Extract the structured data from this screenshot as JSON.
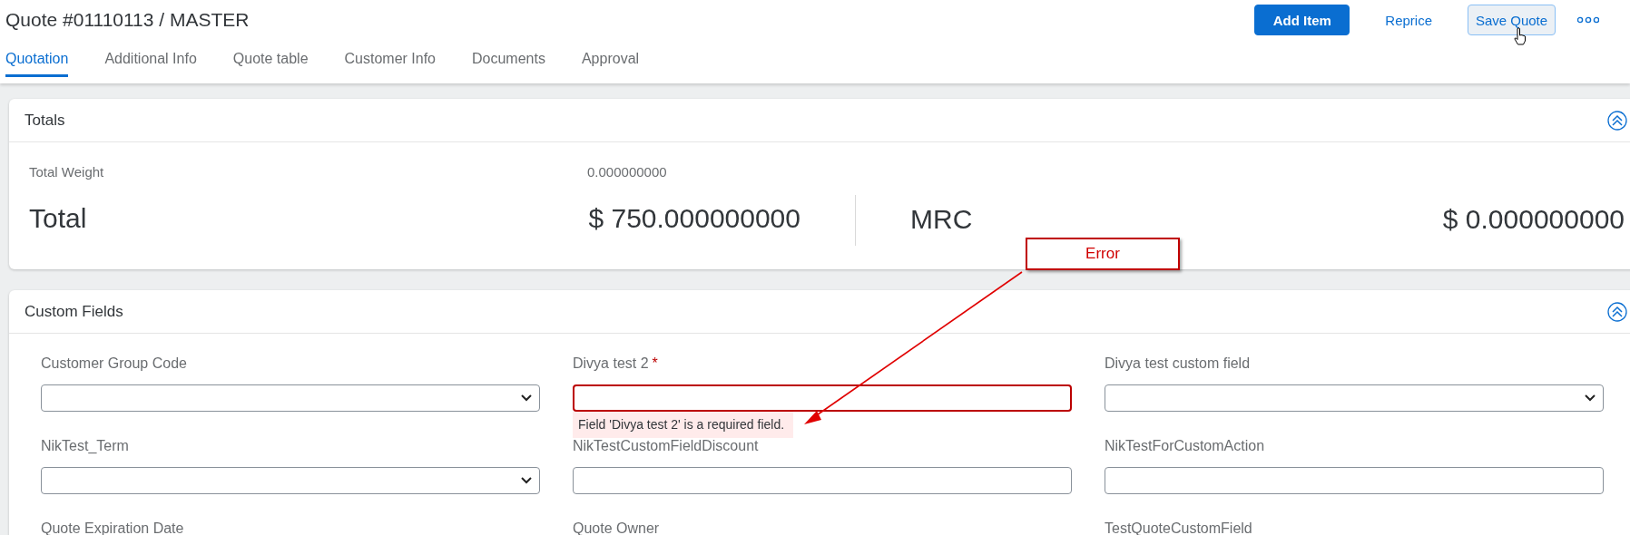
{
  "header": {
    "title": "Quote #01110113 / MASTER",
    "actions": [
      {
        "label": "Add Item",
        "kind": "primary"
      },
      {
        "label": "Reprice",
        "kind": "link"
      },
      {
        "label": "Save Quote",
        "kind": "hovered"
      },
      {
        "kind": "more"
      }
    ]
  },
  "tabs": [
    {
      "label": "Quotation",
      "selected": true
    },
    {
      "label": "Additional Info",
      "selected": false
    },
    {
      "label": "Quote table",
      "selected": false
    },
    {
      "label": "Customer Info",
      "selected": false
    },
    {
      "label": "Documents",
      "selected": false
    },
    {
      "label": "Approval",
      "selected": false
    }
  ],
  "totals": {
    "title": "Totals",
    "expanded": true,
    "weight_label": "Total Weight",
    "weight_value": "0.000000000",
    "total_label": "Total",
    "total_value": "$ 750.000000000",
    "mrc_label": "MRC",
    "mrc_value": "$ 0.000000000"
  },
  "custom_fields": {
    "title": "Custom Fields",
    "expanded": true,
    "fields": [
      {
        "label": "Customer Group Code",
        "kind": "select"
      },
      {
        "label": "Divya test 2",
        "required_mark": "*",
        "kind": "text",
        "error": "Field 'Divya test 2' is a required field."
      },
      {
        "label": "Divya test custom field",
        "kind": "select"
      },
      {
        "label": "NikTest_Term",
        "kind": "select"
      },
      {
        "label": "NikTestCustomFieldDiscount",
        "kind": "text"
      },
      {
        "label": "NikTestForCustomAction",
        "kind": "text"
      },
      {
        "label": "Quote Expiration Date",
        "kind": "cut"
      },
      {
        "label": "Quote Owner",
        "kind": "cut"
      },
      {
        "label": "TestQuoteCustomField",
        "kind": "cut"
      }
    ]
  },
  "annotation": {
    "label": "Error"
  }
}
